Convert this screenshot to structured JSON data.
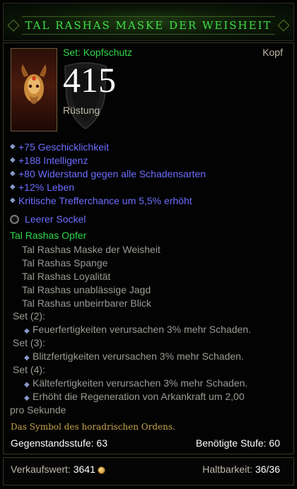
{
  "item": {
    "title": "Tal Rashas Maske der Weisheit",
    "set_type": "Set: Kopfschutz",
    "slot": "Kopf",
    "armor": "415",
    "armor_label": "Rüstung",
    "icon": "mask-icon"
  },
  "affixes": [
    "+75 Geschicklichkeit",
    "+188 Intelligenz",
    "+80 Widerstand gegen alle Schadensarten",
    "+12% Leben",
    "Kritische Trefferchance um 5,5% erhöht"
  ],
  "socket": {
    "label": "Leerer Sockel"
  },
  "set": {
    "name": "Tal Rashas Opfer",
    "items": [
      "Tal Rashas Maske der Weisheit",
      "Tal Rashas Spange",
      "Tal Rashas Loyalität",
      "Tal Rashas unablässige Jagd",
      "Tal Rashas unbeirrbarer Blick"
    ],
    "bonuses": [
      {
        "label": "Set (2):",
        "lines": [
          "Feuerfertigkeiten verursachen 3% mehr Schaden."
        ]
      },
      {
        "label": "Set (3):",
        "lines": [
          "Blitzfertigkeiten verursachen 3% mehr Schaden."
        ]
      },
      {
        "label": "Set (4):",
        "lines": [
          "Kältefertigkeiten verursachen 3% mehr Schaden.",
          "Erhöht die Regeneration von Arkankraft um 2,00",
          "pro Sekunde"
        ]
      }
    ]
  },
  "flavor": "Das Symbol des horadrischen Ordens.",
  "requirements": {
    "item_level_label": "Gegenstandsstufe:",
    "item_level": "63",
    "required_level_label": "Benötigte Stufe:",
    "required_level": "60"
  },
  "footer": {
    "sell_label": "Verkaufswert:",
    "sell_value": "3641",
    "durability_label": "Haltbarkeit:",
    "durability_value": "36/36"
  },
  "colors": {
    "set_green": "#2fd84a",
    "magic_blue": "#6d6dff",
    "gray": "#9a9a94",
    "flavor_gold": "#c9a54a"
  }
}
